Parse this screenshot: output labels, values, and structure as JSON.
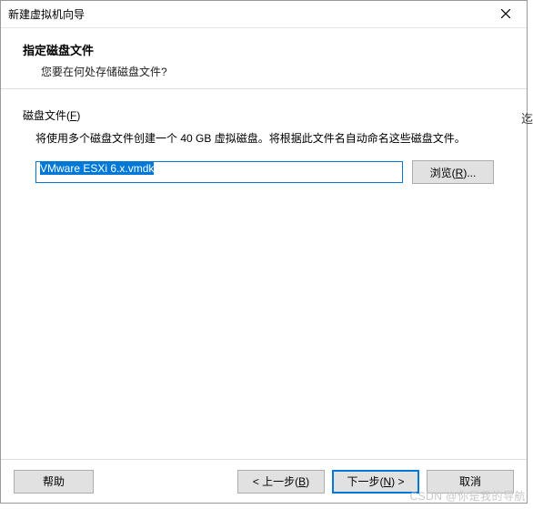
{
  "titlebar": {
    "title": "新建虚拟机向导"
  },
  "header": {
    "title": "指定磁盘文件",
    "subtitle": "您要在何处存储磁盘文件?"
  },
  "group": {
    "label": "磁盘文件(",
    "mnemonic": "F",
    "label_suffix": ")",
    "description": "将使用多个磁盘文件创建一个 40 GB 虚拟磁盘。将根据此文件名自动命名这些磁盘文件。"
  },
  "input": {
    "file_value": "VMware ESXi 6.x.vmdk"
  },
  "buttons": {
    "browse": "浏览(",
    "browse_mnemonic": "R",
    "browse_suffix": ")...",
    "help": "帮助",
    "back_pre": "< 上一步(",
    "back_mnemonic": "B",
    "back_suffix": ")",
    "next_pre": "下一步(",
    "next_mnemonic": "N",
    "next_suffix": ") >",
    "cancel": "取消"
  },
  "side_text": "迄",
  "watermark": "CSDN @你是我的导航"
}
